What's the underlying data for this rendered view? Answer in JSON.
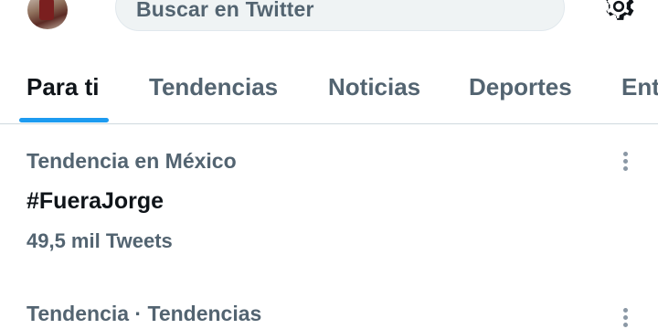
{
  "search": {
    "placeholder": "Buscar en Twitter"
  },
  "tabs": [
    {
      "label": "Para ti",
      "active": true
    },
    {
      "label": "Tendencias",
      "active": false
    },
    {
      "label": "Noticias",
      "active": false
    },
    {
      "label": "Deportes",
      "active": false
    },
    {
      "label": "Ent",
      "active": false
    }
  ],
  "trends": [
    {
      "context": "Tendencia en México",
      "title": "#FueraJorge",
      "count": "49,5 mil Tweets"
    },
    {
      "context": "Tendencia · Tendencias"
    }
  ],
  "colors": {
    "accent": "#1d9bf0",
    "text_primary": "#0f1419",
    "text_secondary": "#536471",
    "search_bg": "#eff3f4",
    "divider": "#cfd9de"
  },
  "icons": {
    "settings": "gear-icon",
    "more": "more-vertical-icon"
  }
}
